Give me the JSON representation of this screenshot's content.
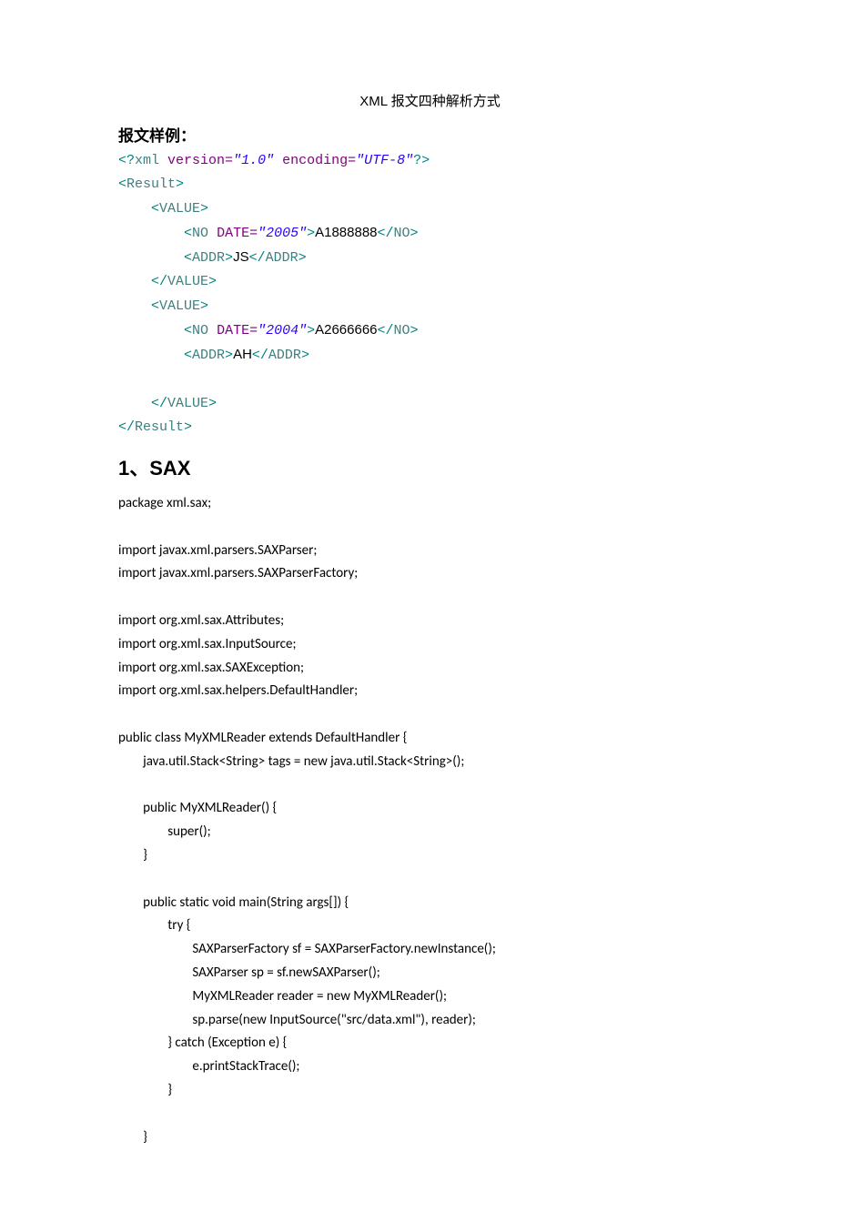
{
  "title": "XML 报文四种解析方式",
  "sample_heading": "报文样例：",
  "xml": {
    "decl": {
      "open": "<?",
      "xml": "xml",
      "ver_attr": "version=",
      "ver_val": "\"1.0\"",
      "enc_attr": "encoding=",
      "enc_val": "\"UTF-8\"",
      "close": "?>"
    },
    "result_open": "Result",
    "value": "VALUE",
    "no": "NO",
    "date_attr": "DATE=",
    "date1": "\"2005\"",
    "no1_text": "A1888888",
    "addr": "ADDR",
    "addr1_text": "JS",
    "date2": "\"2004\"",
    "no2_text": "A2666666",
    "addr2_text": "AH",
    "result_close": "Result"
  },
  "section1_heading": "1、SAX",
  "java": {
    "l1": "package xml.sax;",
    "l2": "",
    "l3": "import javax.xml.parsers.SAXParser;",
    "l4": "import javax.xml.parsers.SAXParserFactory;",
    "l5": "",
    "l6": "import org.xml.sax.Attributes;",
    "l7": "import org.xml.sax.InputSource;",
    "l8": "import org.xml.sax.SAXException;",
    "l9": "import org.xml.sax.helpers.DefaultHandler;",
    "l10": "",
    "l11": "public class MyXMLReader extends DefaultHandler {",
    "l12": "        java.util.Stack<String> tags = new java.util.Stack<String>();",
    "l13": "",
    "l14": "        public MyXMLReader() {",
    "l15": "                super();",
    "l16": "        }",
    "l17": "",
    "l18": "        public static void main(String args[]) {",
    "l19": "                try {",
    "l20": "                        SAXParserFactory sf = SAXParserFactory.newInstance();",
    "l21": "                        SAXParser sp = sf.newSAXParser();",
    "l22": "                        MyXMLReader reader = new MyXMLReader();",
    "l23": "                        sp.parse(new InputSource(\"src/data.xml\"), reader);",
    "l24": "                } catch (Exception e) {",
    "l25": "                        e.printStackTrace();",
    "l26": "                }",
    "l27": "",
    "l28": "        }"
  }
}
